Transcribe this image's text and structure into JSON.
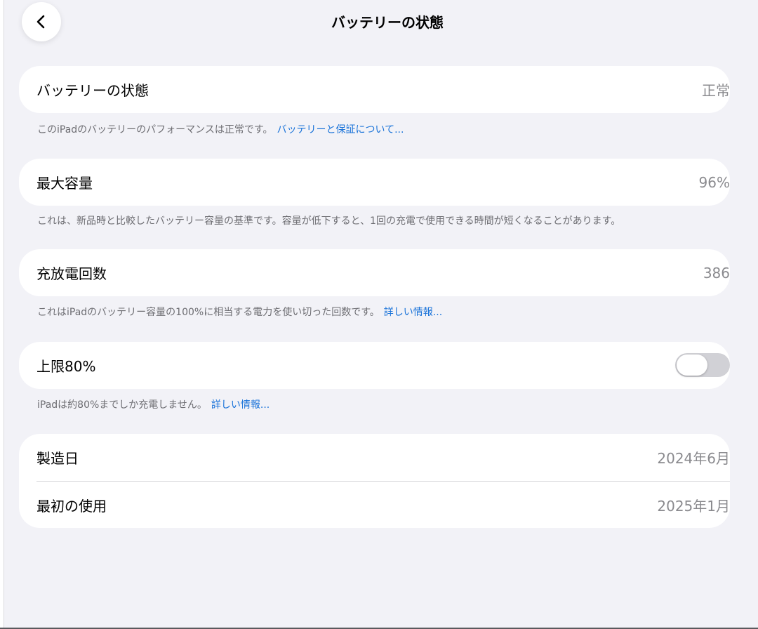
{
  "nav": {
    "title": "バッテリーの状態",
    "back_icon": "chevron-left-icon"
  },
  "battery_health": {
    "label": "バッテリーの状態",
    "value": "正常",
    "footnote_text": "このiPadのバッテリーのパフォーマンスは正常です。",
    "footnote_link": "バッテリーと保証について..."
  },
  "max_capacity": {
    "label": "最大容量",
    "value": "96%",
    "footnote_text": "これは、新品時と比較したバッテリー容量の基準です。容量が低下すると、1回の充電で使用できる時間が短くなることがあります。"
  },
  "cycle_count": {
    "label": "充放電回数",
    "value": "386",
    "footnote_text": "これはiPadのバッテリー容量の100%に相当する電力を使い切った回数です。",
    "footnote_link": "詳しい情報..."
  },
  "limit_80": {
    "label": "上限80%",
    "toggle_on": false,
    "footnote_text": "iPadは約80%までしか充電しません。",
    "footnote_link": "詳しい情報..."
  },
  "dates": {
    "manufacture_label": "製造日",
    "manufacture_value": "2024年6月",
    "first_use_label": "最初の使用",
    "first_use_value": "2025年1月"
  },
  "colors": {
    "background": "#f2f2f7",
    "card": "#ffffff",
    "link": "#1a73d9",
    "secondary_text": "#8a8a8e",
    "toggle_off": "#d1d1d6"
  }
}
